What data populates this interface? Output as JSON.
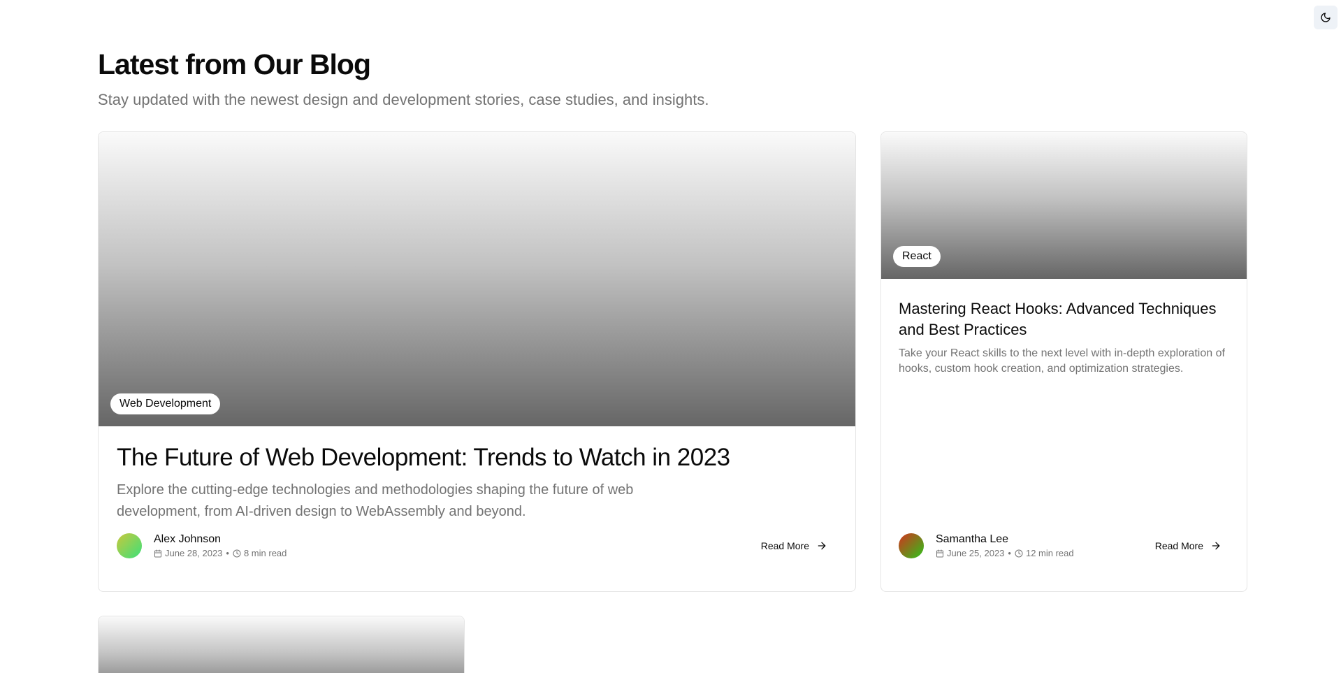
{
  "header": {
    "title": "Latest from Our Blog",
    "subtitle": "Stay updated with the newest design and development stories, case studies, and insights."
  },
  "theme_toggle": {
    "icon": "moon-icon"
  },
  "posts": [
    {
      "category": "Web Development",
      "title": "The Future of Web Development: Trends to Watch in 2023",
      "excerpt": "Explore the cutting-edge technologies and methodologies shaping the future of web development, from AI-driven design to WebAssembly and beyond.",
      "author": "Alex Johnson",
      "date": "June 28, 2023",
      "read_time": "8 min read",
      "read_more": "Read More",
      "avatar_colors": [
        "#c8c83c",
        "#3ce07a"
      ]
    },
    {
      "category": "React",
      "title": "Mastering React Hooks: Advanced Techniques and Best Practices",
      "excerpt": "Take your React skills to the next level with in-depth exploration of hooks, custom hook creation, and optimization strategies.",
      "author": "Samantha Lee",
      "date": "June 25, 2023",
      "read_time": "12 min read",
      "read_more": "Read More",
      "avatar_colors": [
        "#d4321e",
        "#2cc41a"
      ]
    }
  ]
}
